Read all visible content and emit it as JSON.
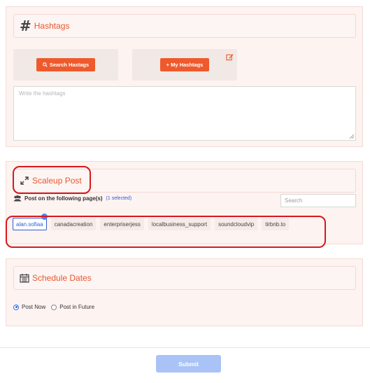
{
  "hashtags": {
    "title": "Hashtags",
    "search_button": "Search Hastags",
    "my_button": "+ My Hashtags",
    "textarea_placeholder": "Write the hashtags"
  },
  "scaleup": {
    "title": "Scaleup Post",
    "post_on_label": "Post on the following page(s)",
    "selected_count": "(1 selected)",
    "search_placeholder": "Search",
    "pages": [
      {
        "label": "alan.sofiaa",
        "selected": true
      },
      {
        "label": "canadacreation",
        "selected": false
      },
      {
        "label": "enterpriserjess",
        "selected": false
      },
      {
        "label": "localbusiness_support",
        "selected": false
      },
      {
        "label": "soundcloudvip",
        "selected": false
      },
      {
        "label": "tirbnb.to",
        "selected": false
      }
    ]
  },
  "schedule": {
    "title": "Schedule Dates",
    "options": [
      {
        "label": "Post Now",
        "checked": true
      },
      {
        "label": "Post in Future",
        "checked": false
      }
    ]
  },
  "submit_label": "Submit",
  "colors": {
    "accent": "#e8572f",
    "button": "#ee5a2c",
    "selected": "#2b5fd9",
    "highlight": "#d7191c",
    "submit": "#a9c3f7"
  }
}
